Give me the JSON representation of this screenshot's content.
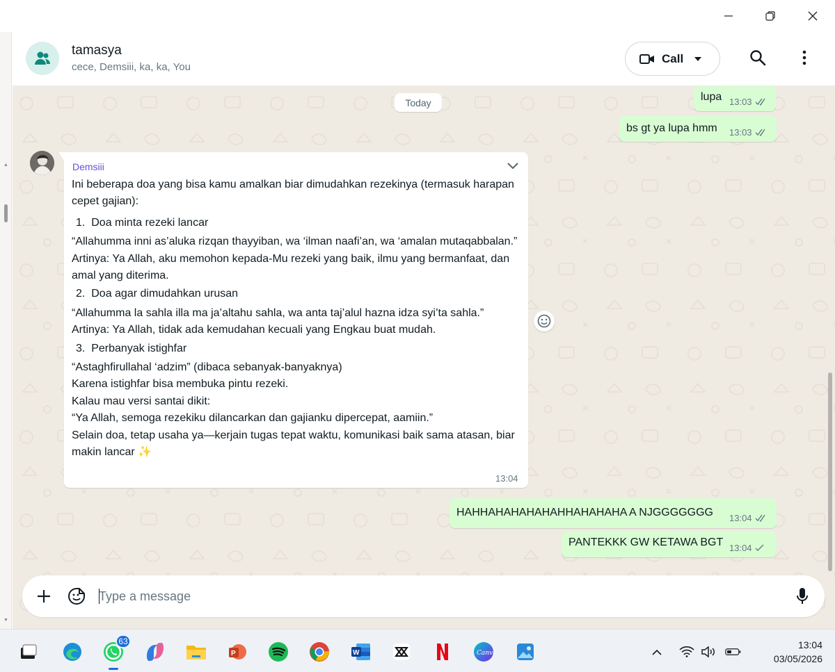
{
  "chat": {
    "title": "tamasya",
    "participants": "cece, Demsiii, ka, ka, You",
    "call_label": "Call"
  },
  "date_divider": "Today",
  "outgoing_top": [
    {
      "text": "lupa",
      "time": "13:03",
      "status": "read"
    },
    {
      "text": "bs gt ya lupa hmm",
      "time": "13:03",
      "status": "read"
    }
  ],
  "incoming": {
    "sender": "Demsiii",
    "time": "13:04",
    "intro": "Ini beberapa doa yang bisa kamu amalkan biar dimudahkan rezekinya (termasuk harapan cepet gajian):",
    "item1": "Doa minta rezeki lancar",
    "item1_arabic": "“Allahumma inni as’aluka rizqan thayyiban, wa ‘ilman naafi’an, wa ‘amalan mutaqabbalan.”",
    "item1_meaning": "Artinya: Ya Allah, aku memohon kepada-Mu rezeki yang baik, ilmu yang bermanfaat, dan amal yang diterima.",
    "item2": "Doa agar dimudahkan urusan",
    "item2_arabic": "“Allahumma la sahla illa ma ja’altahu sahla, wa anta taj’alul hazna idza syi’ta sahla.”",
    "item2_meaning": "Artinya: Ya Allah, tidak ada kemudahan kecuali yang Engkau buat mudah.",
    "item3": "Perbanyak istighfar",
    "item3_arabic": "“Astaghfirullahal ‘adzim” (dibaca sebanyak-banyaknya)",
    "item3_meaning": "Karena istighfar bisa membuka pintu rezeki.",
    "casual_intro": "Kalau mau versi santai dikit:",
    "casual_prayer": "“Ya Allah, semoga rezekiku dilancarkan dan gajianku dipercepat, aamiin.”",
    "closing": "Selain doa, tetap usaha ya—kerjain tugas tepat waktu, komunikasi baik sama atasan, biar makin lancar ✨"
  },
  "outgoing_bottom": [
    {
      "text": "HAHHAHAHAHAHAHHAHAHAHA A NJGGGGGGG",
      "time": "13:04",
      "status": "read"
    },
    {
      "text": "PANTEKKK GW KETAWA BGT",
      "time": "13:04",
      "status": "sent"
    }
  ],
  "composer": {
    "placeholder": "Type a message"
  },
  "taskbar": {
    "whatsapp_badge": "63",
    "time": "13:04",
    "date": "03/05/2026",
    "apps": [
      "task-view-icon",
      "edge-icon",
      "whatsapp-icon",
      "copilot-icon",
      "file-explorer-icon",
      "powerpoint-icon",
      "spotify-icon",
      "chrome-icon",
      "word-icon",
      "capcut-icon",
      "netflix-icon",
      "canva-icon",
      "photos-icon"
    ]
  },
  "colors": {
    "outgoing_bubble": "#d9fdd3",
    "chat_bg": "#efeae2",
    "read_tick": "#53bdeb",
    "accent": "#00a884",
    "sender_name": "#6b4dd6"
  }
}
